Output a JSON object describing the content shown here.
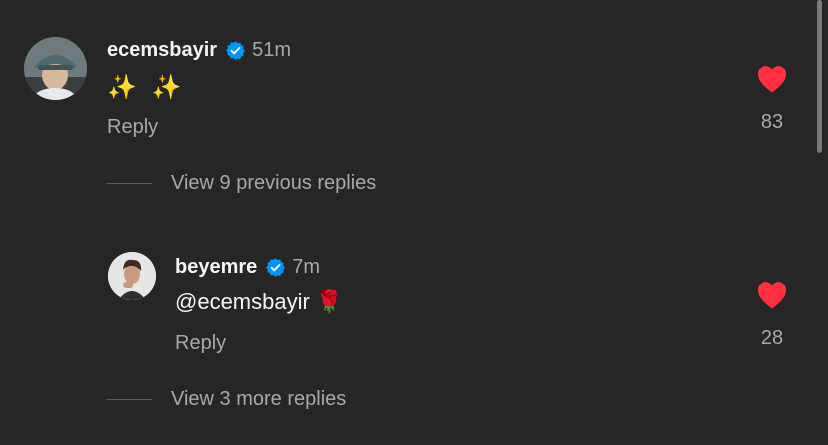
{
  "comments": [
    {
      "username": "ecemsbayir",
      "verified": true,
      "timestamp": "51m",
      "text": "✨ ✨",
      "reply_label": "Reply",
      "likes": "83",
      "liked": true
    }
  ],
  "view_previous": "View 9 previous replies",
  "replies": [
    {
      "username": "beyemre",
      "verified": true,
      "timestamp": "7m",
      "text": "@ecemsbayir 🌹",
      "reply_label": "Reply",
      "likes": "28",
      "liked": true
    }
  ],
  "view_more": "View 3 more replies",
  "colors": {
    "background": "#262626",
    "heart": "#ff3040",
    "verified": "#0095f6",
    "secondary_text": "#a8a8a8"
  },
  "icons": {
    "verified": "verified-badge-icon",
    "heart": "heart-filled-icon"
  }
}
